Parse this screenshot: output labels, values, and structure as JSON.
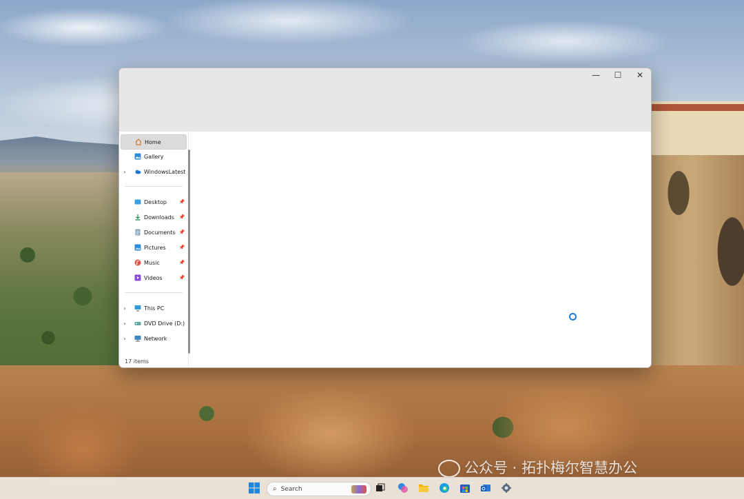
{
  "window": {
    "controls": {
      "minimize": "—",
      "maximize": "☐",
      "close": "✕"
    }
  },
  "sidebar": {
    "items": [
      {
        "label": "Home",
        "icon": "home-icon"
      },
      {
        "label": "Gallery",
        "icon": "gallery-icon"
      },
      {
        "label": "WindowsLatest",
        "icon": "onedrive-icon",
        "expandable": true
      }
    ],
    "pinned": [
      {
        "label": "Desktop",
        "icon": "desktop-icon"
      },
      {
        "label": "Downloads",
        "icon": "download-icon"
      },
      {
        "label": "Documents",
        "icon": "documents-icon"
      },
      {
        "label": "Pictures",
        "icon": "pictures-icon"
      },
      {
        "label": "Music",
        "icon": "music-icon"
      },
      {
        "label": "Videos",
        "icon": "videos-icon"
      }
    ],
    "drives": [
      {
        "label": "This PC",
        "icon": "pc-icon"
      },
      {
        "label": "DVD Drive (D:) C",
        "icon": "dvd-drive-icon"
      },
      {
        "label": "Network",
        "icon": "network-icon"
      }
    ]
  },
  "status": {
    "item_count": "17 items"
  },
  "taskbar": {
    "search_placeholder": "Search"
  },
  "watermark": {
    "text": "公众号 · 拓扑梅尔智慧办公"
  },
  "colors": {
    "accent": "#1f7bd1",
    "titlebar": "#e7e7e7",
    "selected": "#dcdcdc"
  }
}
